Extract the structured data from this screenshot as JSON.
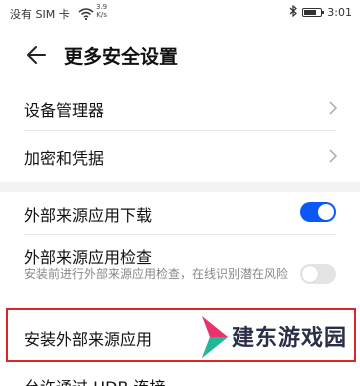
{
  "status_bar": {
    "carrier": "没有 SIM 卡",
    "speed_value": "3.9",
    "speed_unit": "K/s",
    "time": "3:01",
    "battery_level": 0.8
  },
  "header": {
    "title": "更多安全设置"
  },
  "items": {
    "device_manager": "设备管理器",
    "encryption": "加密和凭据",
    "external_download": {
      "label": "外部来源应用下载",
      "enabled": true
    },
    "external_check": {
      "label": "外部来源应用检查",
      "description": "安装前进行外部来源应用检查，在线识别潜在风险",
      "enabled": false
    },
    "install_external": "安装外部来源应用",
    "usb_partial": "允许通过 HDB 连接"
  },
  "colors": {
    "accent": "#0a59f7",
    "highlight": "#d9262b",
    "watermark_red": "#e8336d",
    "watermark_teal": "#1fb89a"
  },
  "watermark": {
    "text": "建东游戏园"
  }
}
